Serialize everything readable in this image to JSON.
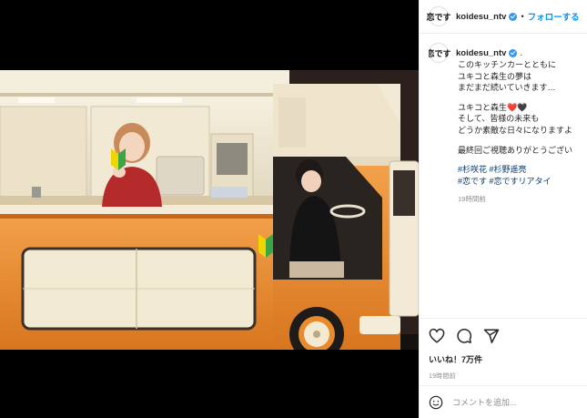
{
  "header": {
    "avatar_text": "恋です",
    "username": "koidesu_ntv",
    "dot": "•",
    "follow_label": "フォローする"
  },
  "caption": {
    "username": "koidesu_ntv",
    "trailing": ".",
    "lines": [
      "このキッチンカーとともに",
      "ユキコと森生の夢は",
      "まだまだ続いていきます…",
      "",
      "ユキコと森生❤️🖤",
      "そして、皆様の未来も",
      "どうか素敵な日々になりますよ",
      "",
      "最終回ご視聴ありがとうござい"
    ],
    "hashtags_1": "#杉咲花 #杉野遥亮",
    "hashtags_2": "#恋です #恋ですリアタイ",
    "time": "19時間前"
  },
  "actions": {
    "likes": "いいね！7万件",
    "ago": "19時間前"
  },
  "comment": {
    "placeholder": "コメントを追加..."
  },
  "colors": {
    "accent": "#0095f6",
    "verified": "#3897f0",
    "van_orange": "#e98a2c",
    "van_cream": "#f3ead4"
  },
  "icons": [
    "heart-icon",
    "comment-icon",
    "share-icon",
    "emoji-icon",
    "verified-icon",
    "beginner-mark-icon"
  ]
}
